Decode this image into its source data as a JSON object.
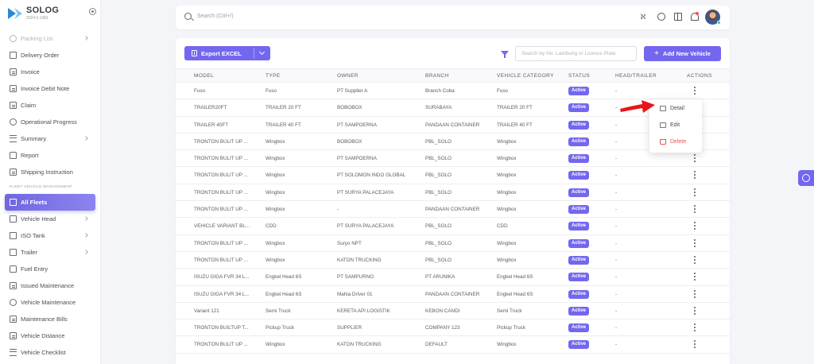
{
  "brand": {
    "name": "SOLOG",
    "subtitle": "2024.6.1481"
  },
  "search": {
    "placeholder": "Search (Ctrl+/)"
  },
  "sidebar": {
    "items_top": [
      {
        "label": "Packing List",
        "icon": "box-icon",
        "chevron": true,
        "faded": true
      },
      {
        "label": "Delivery Order",
        "icon": "truck-icon"
      },
      {
        "label": "Invoice",
        "icon": "file-icon"
      },
      {
        "label": "Invoice Debit Note",
        "icon": "file-icon"
      },
      {
        "label": "Claim",
        "icon": "file-icon"
      },
      {
        "label": "Operational Progress",
        "icon": "progress-icon"
      },
      {
        "label": "Summary",
        "icon": "summary-icon",
        "chevron": true
      },
      {
        "label": "Report",
        "icon": "report-icon"
      },
      {
        "label": "Shipping Instruction",
        "icon": "instruction-icon"
      }
    ],
    "section_label": "FLEET VEHICLE MANAGEMENT",
    "items_fleet": [
      {
        "label": "All Fleets",
        "icon": "fleet-icon",
        "active": true
      },
      {
        "label": "Vehicle Head",
        "icon": "truck-icon",
        "chevron": true
      },
      {
        "label": "ISO Tank",
        "icon": "tank-icon",
        "chevron": true
      },
      {
        "label": "Trailer",
        "icon": "trailer-icon",
        "chevron": true
      },
      {
        "label": "Fuel Entry",
        "icon": "fuel-icon"
      },
      {
        "label": "Issued Maintenance",
        "icon": "maintenance-icon"
      },
      {
        "label": "Vehicle Maintenance",
        "icon": "wrench-icon"
      },
      {
        "label": "Maintenance Bills",
        "icon": "bill-icon"
      },
      {
        "label": "Vehicle Distance",
        "icon": "distance-icon"
      },
      {
        "label": "Vehicle Checklist",
        "icon": "checklist-icon"
      }
    ]
  },
  "toolbar": {
    "export_label": "Export EXCEL",
    "table_search_placeholder": "Search by No. Lambung or Licence Plate",
    "add_label": "Add New Vehicle"
  },
  "table": {
    "headers": [
      "MODEL",
      "TYPE",
      "OWNER",
      "BRANCH",
      "VEHICLE CATEGORY",
      "STATUS",
      "HEAD/TRAILER",
      "ACTIONS"
    ],
    "rows": [
      [
        "Fuso",
        "Fuso",
        "PT Supplier A",
        "Branch Coba",
        "Fuso",
        "Active",
        "-"
      ],
      [
        "TRAILER20FT",
        "TRAILER 20 FT",
        "BOBOBOX",
        "SURABAYA",
        "TRAILER 20 FT",
        "Active",
        "-"
      ],
      [
        "TRAILER 40FT",
        "TRAILER 40 FT",
        "PT SAMPOERNA",
        "PANDAAN CONTAINER",
        "TRAILER 40 FT",
        "Active",
        "-"
      ],
      [
        "TRONTON BULIT UP ...",
        "Wingbox",
        "BOBOBOX",
        "PBL_SOLO",
        "Wingbox",
        "Active",
        "-"
      ],
      [
        "TRONTON BULIT UP ...",
        "Wingbox",
        "PT SAMPOERNA",
        "PBL_SOLO",
        "Wingbox",
        "Active",
        "-"
      ],
      [
        "TRONTON BULIT UP ...",
        "Wingbox",
        "PT SOLOMON INDO GLOBAL",
        "PBL_SOLO",
        "Wingbox",
        "Active",
        "-"
      ],
      [
        "TRONTON BULIT UP ...",
        "Wingbox",
        "PT SURYA PALACEJAYA",
        "PBL_SOLO",
        "Wingbox",
        "Active",
        "-"
      ],
      [
        "TRONTON BULIT UP ...",
        "Wingbox",
        "-",
        "PANDAAN CONTAINER",
        "Wingbox",
        "Active",
        "-"
      ],
      [
        "VEHICLE VARIANT BL...",
        "CDD",
        "PT SURYA PALACEJAYA",
        "PBL_SOLO",
        "CDD",
        "Active",
        "-"
      ],
      [
        "TRONTON BULIT UP ...",
        "Wingbox",
        "Suryo NPT",
        "PBL_SOLO",
        "Wingbox",
        "Active",
        "-"
      ],
      [
        "TRONTON BULIT UP ...",
        "Wingbox",
        "KATON TRUCKING",
        "PBL_SOLO",
        "Wingbox",
        "Active",
        "-"
      ],
      [
        "ISUZU GIGA FVR 34 L...",
        "Engkel Head 6S",
        "PT SAMPURNO",
        "PT ARUNIKA",
        "Engkel Head 6S",
        "Active",
        "-"
      ],
      [
        "ISUZU GIGA FVR 34 L...",
        "Engkel Head 6S",
        "Mahia Driver 01",
        "PANDAAN CONTAINER",
        "Engkel Head 6S",
        "Active",
        "-"
      ],
      [
        "Variant 121",
        "Semi Truck",
        "KERETA API LOGISTIK",
        "KEBON CANDI",
        "Semi Truck",
        "Active",
        "-"
      ],
      [
        "TRONTON BUILTUP T...",
        "Pickup Truck",
        "SUPPLIER",
        "COMPANY 123",
        "Pickup Truck",
        "Active",
        "-"
      ],
      [
        "TRONTON BULIT UP ...",
        "Wingbox",
        "KATON TRUCKING",
        "DEFAULT",
        "Wingbox",
        "Active",
        "-"
      ]
    ]
  },
  "dropdown": {
    "items": [
      {
        "label": "Detail",
        "icon": "folder-icon"
      },
      {
        "label": "Edit",
        "icon": "edit-icon"
      },
      {
        "label": "Delete",
        "icon": "trash-icon"
      }
    ]
  },
  "colors": {
    "accent": "#7367f0",
    "danger": "#ea5455",
    "arrow": "#e8151b"
  }
}
